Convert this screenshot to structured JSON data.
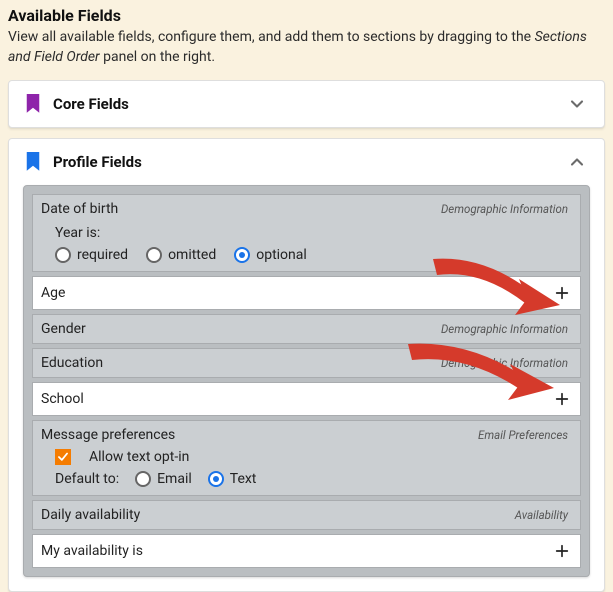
{
  "header": {
    "title": "Available Fields",
    "subtitle_pre": "View all available fields, configure them, and add them to sections by dragging to the ",
    "subtitle_em": "Sections and Field Order",
    "subtitle_post": " panel on the right."
  },
  "panels": {
    "core": {
      "label": "Core Fields",
      "expanded": false
    },
    "profile": {
      "label": "Profile Fields",
      "expanded": true
    }
  },
  "tags": {
    "demographic": "Demographic Information",
    "email_prefs": "Email Preferences",
    "availability": "Availability"
  },
  "fields": {
    "dob": {
      "label": "Date of birth",
      "subtitle": "Year is:",
      "options": {
        "required": "required",
        "omitted": "omitted",
        "optional": "optional"
      },
      "selected": "optional"
    },
    "age": {
      "label": "Age"
    },
    "gender": {
      "label": "Gender"
    },
    "education": {
      "label": "Education"
    },
    "school": {
      "label": "School"
    },
    "msgprefs": {
      "label": "Message preferences",
      "checkbox_label": "Allow text opt-in",
      "checkbox_checked": true,
      "default_label": "Default to:",
      "options": {
        "email": "Email",
        "text": "Text"
      },
      "selected": "text"
    },
    "daily_avail": {
      "label": "Daily availability"
    },
    "my_avail": {
      "label": "My availability is"
    }
  },
  "colors": {
    "accent_blue": "#1a73e8",
    "accent_orange": "#f57c00",
    "purple": "#8e24aa",
    "arrow_red": "#d53a2b"
  }
}
